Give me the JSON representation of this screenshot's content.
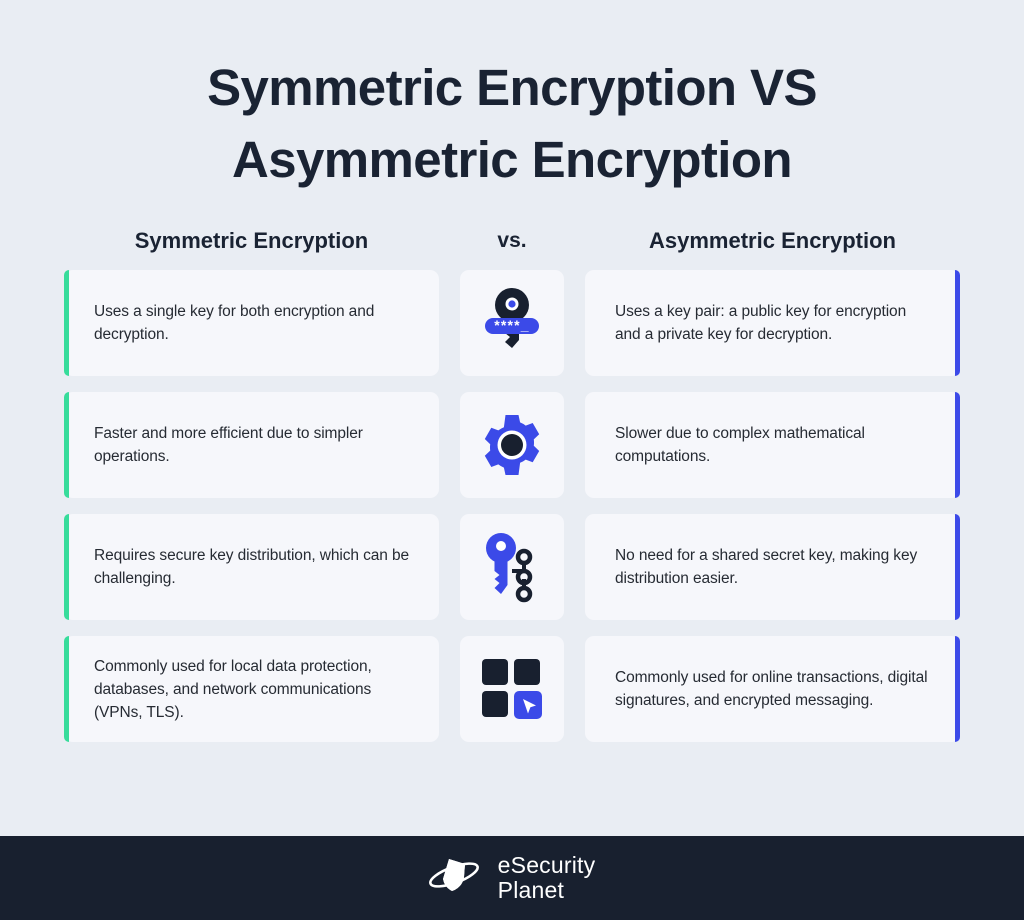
{
  "title": {
    "line1": "Symmetric Encryption VS",
    "line2": "Asymmetric Encryption"
  },
  "headers": {
    "left": "Symmetric Encryption",
    "middle": "vs.",
    "right": "Asymmetric Encryption"
  },
  "rows": [
    {
      "icon": "password-key-icon",
      "left": "Uses a single key for both encryption and decryption.",
      "right": "Uses a key pair: a public key for encryption and a private key for decryption."
    },
    {
      "icon": "gear-icon",
      "left": "Faster and more efficient due to simpler operations.",
      "right": "Slower due to complex mathematical computations."
    },
    {
      "icon": "key-network-icon",
      "left": "Requires secure key distribution, which can be challenging.",
      "right": "No need for a shared secret key, making key distribution easier."
    },
    {
      "icon": "apps-grid-cursor-icon",
      "left": "Commonly used for local data protection, databases, and network communications (VPNs, TLS).",
      "right": "Commonly used for online transactions, digital signatures, and encrypted messaging."
    }
  ],
  "icon_details": {
    "password_mask": "****_"
  },
  "footer": {
    "logo_line1": "eSecurity",
    "logo_line2": "Planet",
    "logo_icon": "planet-shield-icon"
  },
  "colors": {
    "page_background": "#e9edf3",
    "card_background": "#f6f7fb",
    "accent_symmetric": "#37dc9b",
    "accent_asymmetric": "#3c4ae8",
    "icon_blue": "#3b4ae8",
    "icon_dark": "#18202f",
    "text_dark": "#1a2333",
    "footer_background": "#18202f"
  }
}
